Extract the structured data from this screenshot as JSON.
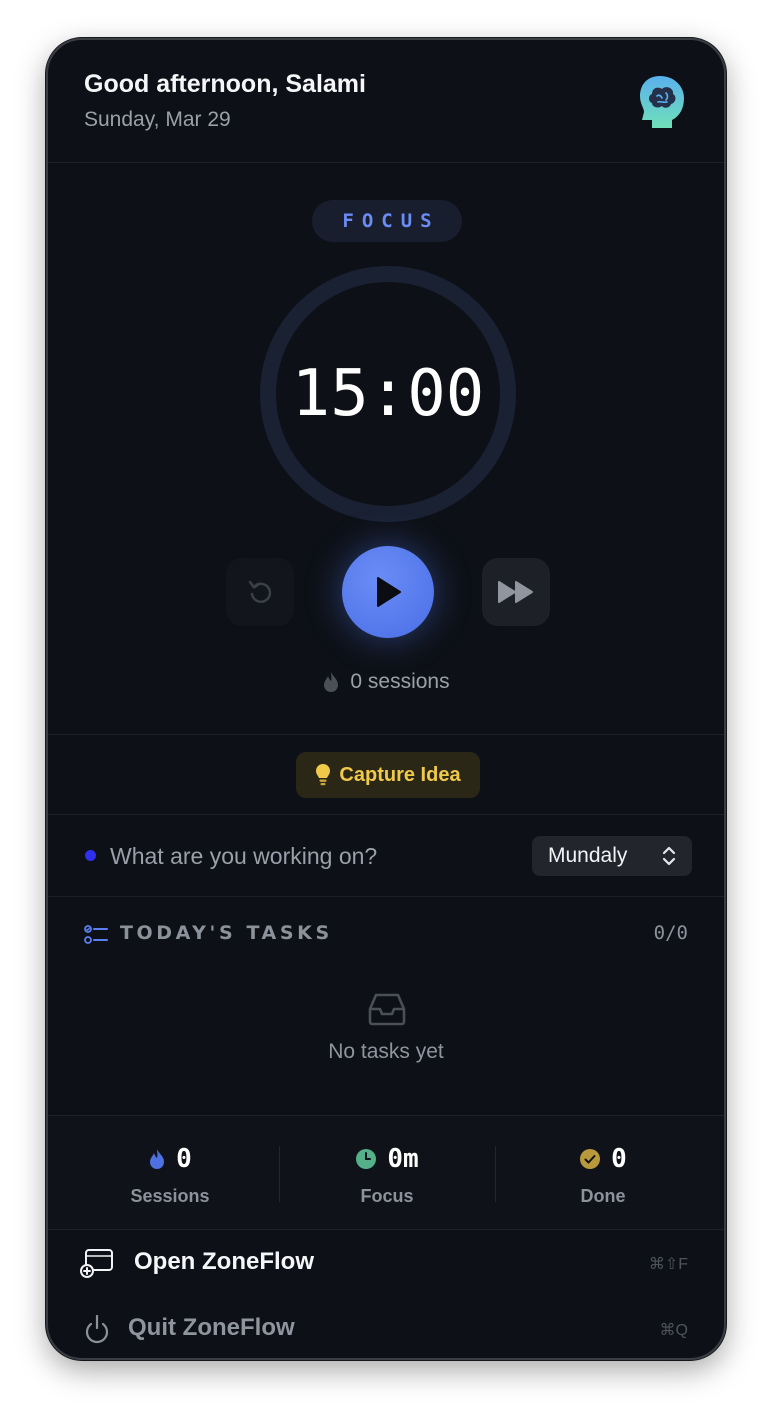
{
  "header": {
    "greeting": "Good afternoon, Salami",
    "date": "Sunday, Mar 29"
  },
  "timer": {
    "mode": "FOCUS",
    "time": "15:00",
    "progress": 0,
    "sessions_text": "0 sessions"
  },
  "capture": {
    "label": "Capture Idea"
  },
  "work": {
    "placeholder": "What are you working on?",
    "project": "Mundaly"
  },
  "tasks": {
    "title": "TODAY'S TASKS",
    "count": "0/0",
    "empty_text": "No tasks yet"
  },
  "stats": [
    {
      "value": "0",
      "label": "Sessions",
      "icon": "flame-icon"
    },
    {
      "value": "0m",
      "label": "Focus",
      "icon": "clock-icon"
    },
    {
      "value": "0",
      "label": "Done",
      "icon": "check-circle-icon"
    }
  ],
  "menu": {
    "open": {
      "label": "Open ZoneFlow",
      "shortcut": "⌘⇧F"
    },
    "quit": {
      "label": "Quit ZoneFlow",
      "shortcut": "⌘Q"
    }
  },
  "colors": {
    "accent": "#5b7ff0",
    "focus_pill_text": "#6b8bf5",
    "capture_text": "#f0c94a",
    "focus_stat": "#55b089",
    "done_stat": "#b89a3c"
  }
}
